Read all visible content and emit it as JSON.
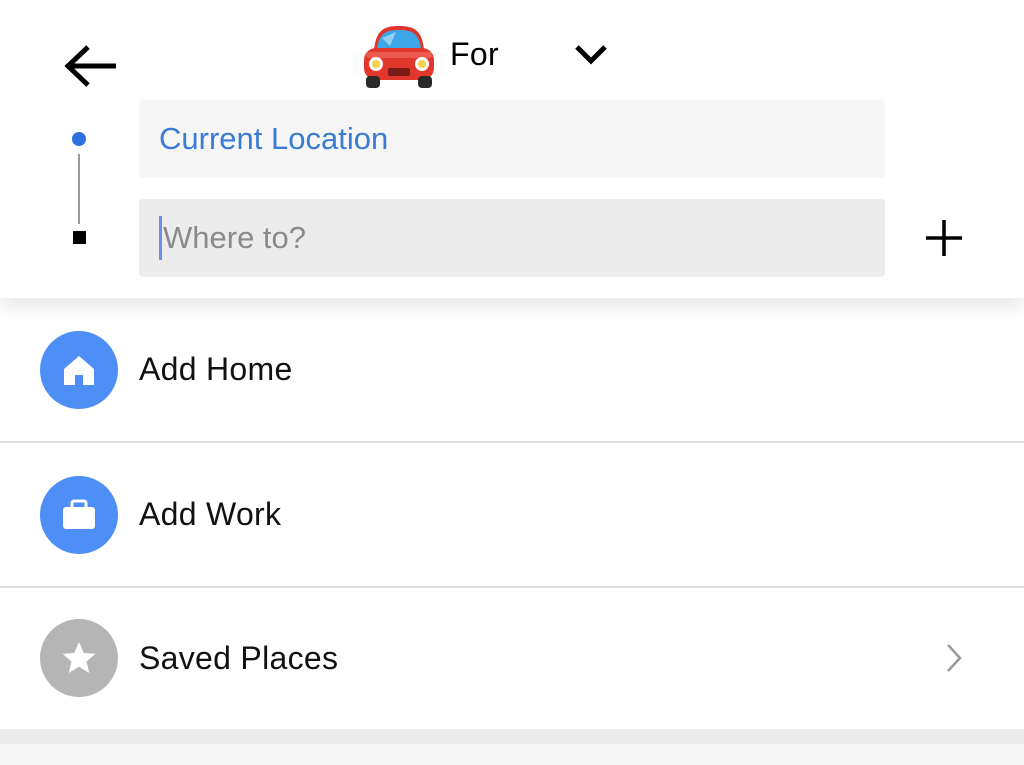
{
  "header": {
    "title": "For",
    "icons": {
      "back": "arrow-left-icon",
      "car": "car-icon",
      "chevron": "chevron-down-icon"
    }
  },
  "trip": {
    "pickup_value": "Current Location",
    "destination_placeholder": "Where to?",
    "add_stop_icon": "plus-icon"
  },
  "places": {
    "items": [
      {
        "label": "Add Home",
        "icon": "home-icon",
        "icon_color": "#4d8ef7"
      },
      {
        "label": "Add Work",
        "icon": "briefcase-icon",
        "icon_color": "#4d8ef7"
      },
      {
        "label": "Saved Places",
        "icon": "star-icon",
        "icon_color": "#b5b5b5"
      }
    ]
  },
  "colors": {
    "accent_blue": "#3a7bd5",
    "route_dot": "#2f6fe0"
  }
}
